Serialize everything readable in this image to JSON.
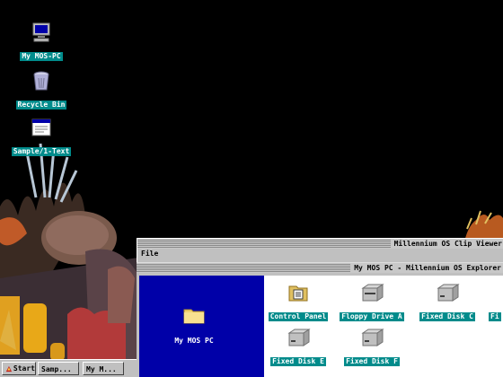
{
  "desktop": {
    "icons": [
      {
        "label": "My MOS-PC",
        "icon": "computer-icon"
      },
      {
        "label": "Recycle Bin",
        "icon": "trash-icon"
      },
      {
        "label": "Sample/1-Text",
        "icon": "text-file-icon"
      }
    ]
  },
  "clip_viewer": {
    "title": "Millennium OS Clip Viewer",
    "menu": [
      "File"
    ]
  },
  "explorer": {
    "title": "My MOS PC - Millennium OS Explorer",
    "tree": [
      {
        "label": "My MOS PC",
        "icon": "folder-icon"
      }
    ],
    "items": [
      {
        "label": "Control Panel",
        "icon": "control-panel-icon"
      },
      {
        "label": "Floppy Drive A",
        "icon": "floppy-drive-icon"
      },
      {
        "label": "Fixed Disk C",
        "icon": "disk-drive-icon"
      },
      {
        "label": "Fixed Disk E",
        "icon": "disk-drive-icon"
      },
      {
        "label": "Fixed Disk F",
        "icon": "disk-drive-icon"
      }
    ],
    "partial_item": {
      "label": "Fi",
      "icon": "disk-drive-icon"
    }
  },
  "taskbar": {
    "start_label": "Start",
    "tasks": [
      {
        "label": "Samp..."
      },
      {
        "label": "My M..."
      }
    ]
  },
  "colors": {
    "desktop_bg": "#000000",
    "label_bg": "#008b8b",
    "tree_bg": "#0000a8",
    "chrome": "#c0c0c0"
  }
}
